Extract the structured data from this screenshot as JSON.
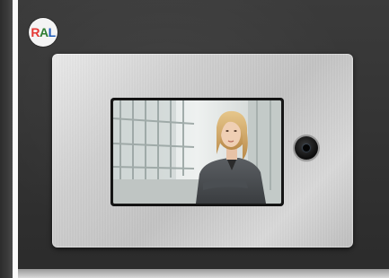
{
  "logo": {
    "letters": [
      "R",
      "A",
      "L"
    ]
  },
  "colors": {
    "logo_r": "#e53935",
    "logo_a": "#2e7d32",
    "logo_l": "#1e5bb8"
  },
  "icons": {
    "logo": "ral-logo",
    "camera": "camera-lens-icon"
  }
}
